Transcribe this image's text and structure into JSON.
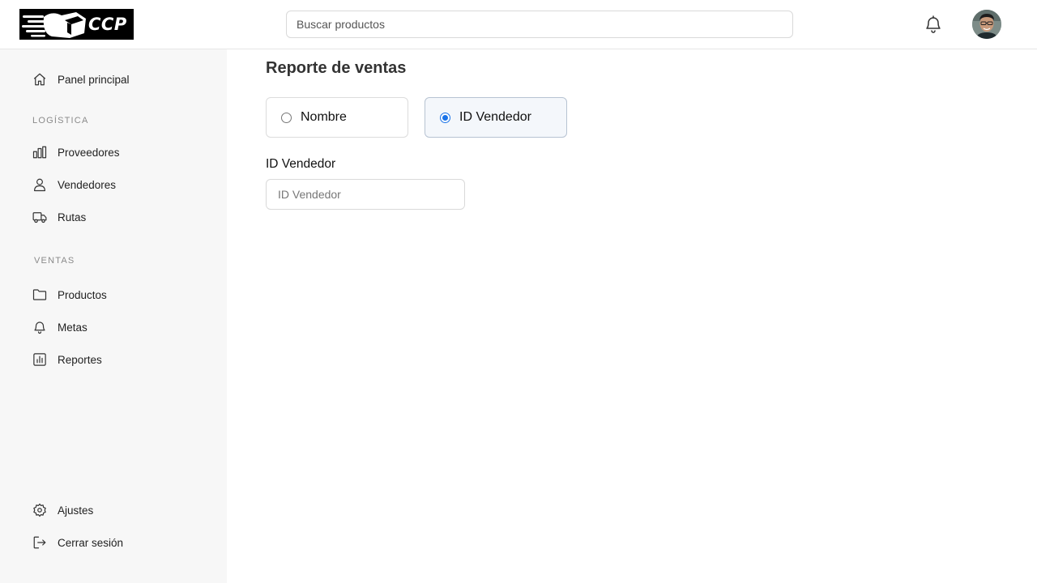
{
  "header": {
    "logo_text": "CCP",
    "search_placeholder": "Buscar productos"
  },
  "sidebar": {
    "top_item": {
      "label": "Panel principal",
      "icon": "home-icon"
    },
    "sections": [
      {
        "label": "LOGÍSTICA",
        "items": [
          {
            "label": "Proveedores",
            "icon": "bar-chart-icon"
          },
          {
            "label": "Vendedores",
            "icon": "user-icon"
          },
          {
            "label": "Rutas",
            "icon": "truck-icon"
          }
        ]
      },
      {
        "label": "VENTAS",
        "items": [
          {
            "label": "Productos",
            "icon": "folder-icon"
          },
          {
            "label": "Metas",
            "icon": "bell-icon"
          },
          {
            "label": "Reportes",
            "icon": "report-chart-icon"
          }
        ]
      }
    ],
    "bottom_items": [
      {
        "label": "Ajustes",
        "icon": "gear-icon"
      },
      {
        "label": "Cerrar sesión",
        "icon": "logout-icon"
      }
    ]
  },
  "main": {
    "title": "Reporte de ventas",
    "options": [
      {
        "label": "Nombre",
        "selected": false
      },
      {
        "label": "ID Vendedor",
        "selected": true
      }
    ],
    "field_label": "ID Vendedor",
    "field_placeholder": "ID Vendedor",
    "field_value": ""
  },
  "colors": {
    "accent": "#1a73e8",
    "sidebar_bg": "#f7f7f7",
    "selected_card_bg": "#f4f7fb"
  }
}
